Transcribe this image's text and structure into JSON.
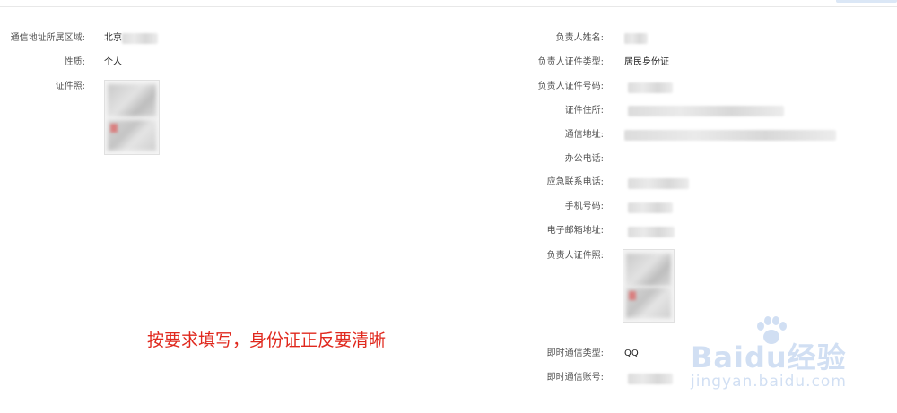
{
  "left_fields": [
    {
      "label": "通信地址所属区域:",
      "value": "北京"
    },
    {
      "label": "性质:",
      "value": "个人"
    },
    {
      "label": "证件照:",
      "value": ""
    }
  ],
  "right_fields": [
    {
      "label": "负责人姓名:",
      "value": ""
    },
    {
      "label": "负责人证件类型:",
      "value": "居民身份证"
    },
    {
      "label": "负责人证件号码:",
      "value": ""
    },
    {
      "label": "证件住所:",
      "value": ""
    },
    {
      "label": "通信地址:",
      "value": ""
    },
    {
      "label": "办公电话:",
      "value": ""
    },
    {
      "label": "应急联系电话:",
      "value": ""
    },
    {
      "label": "手机号码:",
      "value": ""
    },
    {
      "label": "电子邮箱地址:",
      "value": ""
    },
    {
      "label": "负责人证件照:",
      "value": ""
    },
    {
      "label": "即时通信类型:",
      "value": "QQ"
    },
    {
      "label": "即时通信账号:",
      "value": ""
    }
  ],
  "annotation": "按要求填写，身份证正反要清晰",
  "watermark": {
    "brand": "Baidu经验",
    "url": "jingyan.baidu.com",
    "color": "#5c8fd6"
  },
  "colors": {
    "annotation": "#e0281d",
    "label": "#555555",
    "value": "#222222"
  }
}
